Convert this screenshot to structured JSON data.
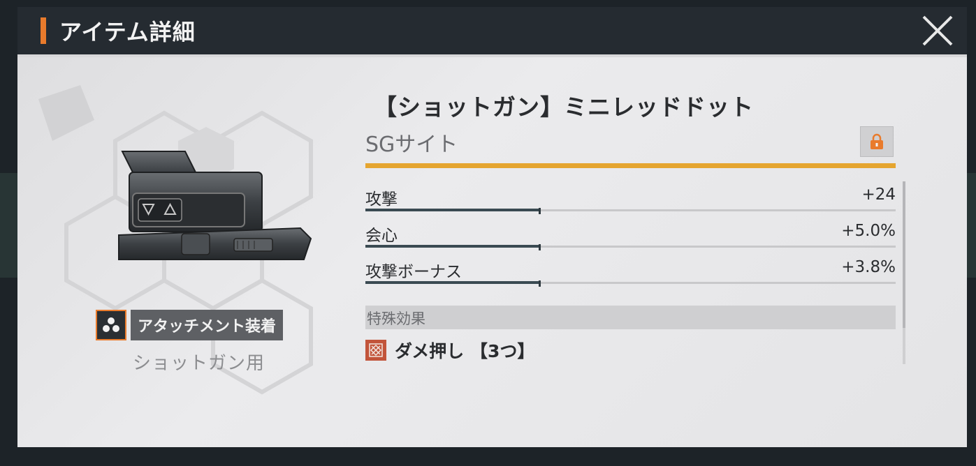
{
  "window": {
    "title": "アイテム詳細",
    "close_icon": "close-x-icon"
  },
  "item": {
    "name": "【ショットガン】ミニレッドドット",
    "type": "SGサイト",
    "attachment_label": "アタッチメント装着",
    "usage": "ショットガン用",
    "rarity_color": "#e5a530",
    "locked": false
  },
  "stats": [
    {
      "label": "攻撃",
      "value": "+24",
      "fill": 0.33
    },
    {
      "label": "会心",
      "value": "+5.0%",
      "fill": 0.33
    },
    {
      "label": "攻撃ボーナス",
      "value": "+3.8%",
      "fill": 0.33
    }
  ],
  "special": {
    "header": "特殊効果",
    "effects": [
      {
        "name": "ダメ押し 【3つ】"
      }
    ]
  },
  "colors": {
    "accent": "#e97b2c",
    "effect_icon": "#c2543a"
  }
}
